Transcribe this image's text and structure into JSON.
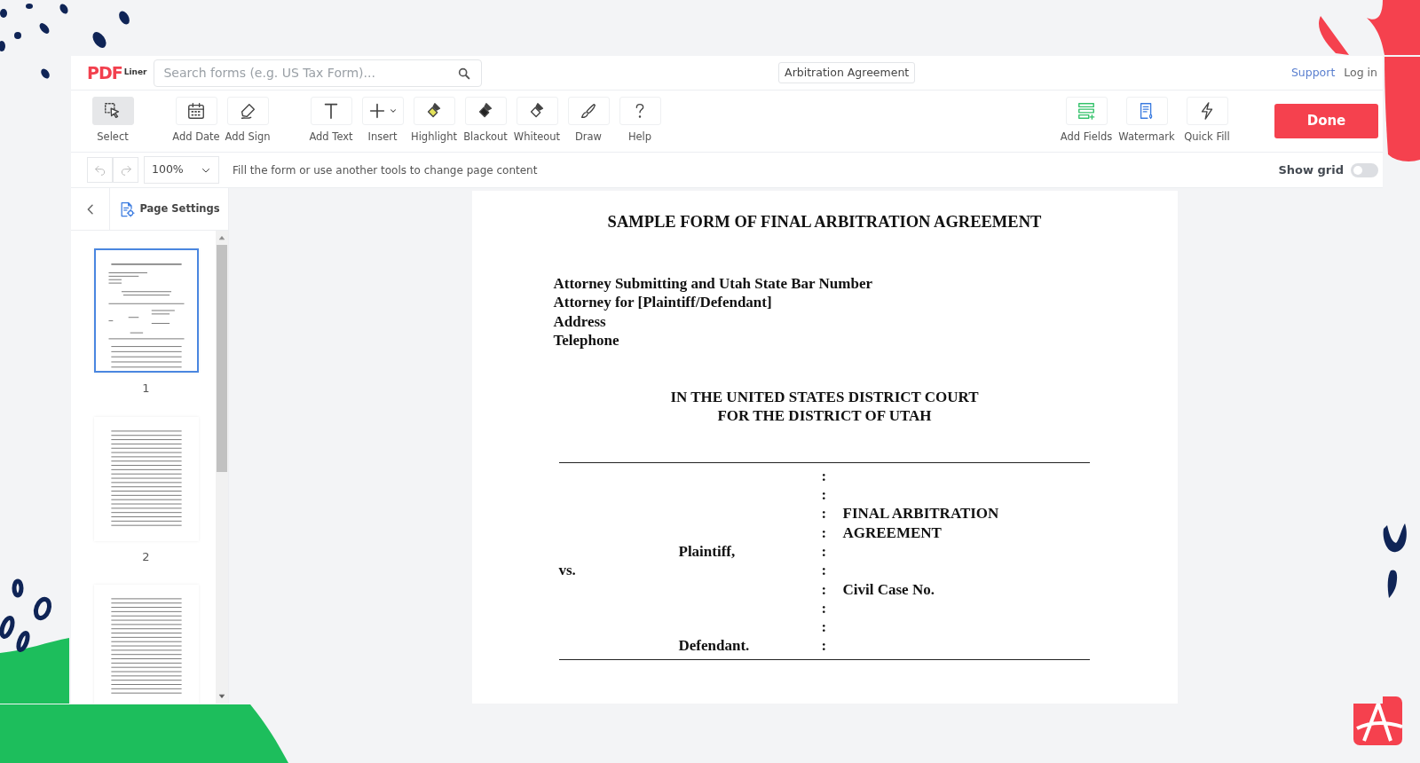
{
  "header": {
    "logo": {
      "main": "PDF",
      "sub": "Liner"
    },
    "search": {
      "placeholder": "Search forms (e.g. US Tax Form)..."
    },
    "document_name": "Arbitration Agreement",
    "links": [
      "Support",
      "Log in"
    ]
  },
  "toolbar": {
    "tools": [
      {
        "label": "Select",
        "kind": "select",
        "selected": true
      },
      {
        "label": "Add Date",
        "kind": "date",
        "selected": false
      },
      {
        "label": "Add Sign",
        "kind": "sign",
        "selected": false
      },
      {
        "label": "Add Text",
        "kind": "text",
        "selected": false
      },
      {
        "label": "Insert",
        "kind": "insert",
        "selected": false
      },
      {
        "label": "Highlight",
        "kind": "highlight",
        "selected": false
      },
      {
        "label": "Blackout",
        "kind": "blackout",
        "selected": false
      },
      {
        "label": "Whiteout",
        "kind": "whiteout",
        "selected": false
      },
      {
        "label": "Draw",
        "kind": "draw",
        "selected": false
      },
      {
        "label": "Help",
        "kind": "help",
        "selected": false
      }
    ],
    "right_tools": [
      {
        "label": "Add Fields",
        "kind": "fields",
        "selected": false
      },
      {
        "label": "Watermark",
        "kind": "watermark",
        "selected": false
      },
      {
        "label": "Quick Fill",
        "kind": "quickfill",
        "selected": false
      }
    ],
    "done_button": "Done"
  },
  "subbar": {
    "zoom": "100%",
    "hint": "Fill the form or use another tools to change page content",
    "show_grid": {
      "label": "Show grid",
      "on": false
    }
  },
  "sidebar": {
    "page_settings": "Page Settings",
    "thumbnails": [
      {
        "number": "1",
        "selected": true
      },
      {
        "number": "2",
        "selected": false
      },
      {
        "selected": false
      }
    ]
  },
  "document": {
    "title": "SAMPLE FORM OF FINAL ARBITRATION AGREEMENT",
    "attorney_lines": [
      "Attorney Submitting and Utah State Bar Number",
      "Attorney for [Plaintiff/Defendant]",
      "Address",
      "Telephone"
    ],
    "court_lines": [
      "IN THE UNITED STATES DISTRICT COURT",
      "FOR THE DISTRICT OF UTAH"
    ],
    "caption_rows": [
      {
        "kind": "party",
        "colon": ":"
      },
      {
        "kind": "party",
        "colon": ":"
      },
      {
        "kind": "party",
        "colon": ":",
        "right": "FINAL ARBITRATION"
      },
      {
        "kind": "party",
        "colon": ":",
        "right": "AGREEMENT"
      },
      {
        "kind": "party",
        "left": "Plaintiff,",
        "colon": ":"
      },
      {
        "kind": "versus",
        "left": "vs.",
        "colon": ":"
      },
      {
        "kind": "party",
        "colon": ":",
        "right": "Civil Case No."
      },
      {
        "kind": "party",
        "colon": ":"
      },
      {
        "kind": "party",
        "colon": ":"
      },
      {
        "kind": "party",
        "left": "Defendant.",
        "colon": ":"
      }
    ]
  }
}
